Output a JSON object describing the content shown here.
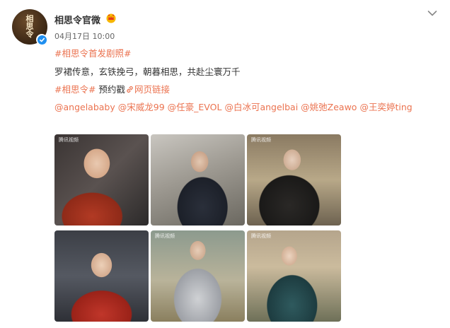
{
  "post": {
    "username": "相思令官微",
    "timestamp": "04月17日 10:00",
    "avatar_text": [
      "相",
      "思",
      "令"
    ],
    "hashtag_line": "#相思令首发剧照#",
    "body_text": "罗裙传意，玄铁挽弓，朝暮相思，共赴尘寰万千",
    "topic_tag": "#相思令#",
    "reserve_text": " 预约戳",
    "web_link_text": "网页链接",
    "mentions": [
      "@angelababy",
      "@宋威龙99",
      "@任豪_EVOL",
      "@白冰可angelbai",
      "@姚弛Zeawo",
      "@王奕婷ting"
    ]
  },
  "photos": [
    {
      "watermark": "腾讯视频"
    },
    {
      "watermark": ""
    },
    {
      "watermark": "腾讯视频"
    },
    {
      "watermark": ""
    },
    {
      "watermark": "腾讯视频"
    },
    {
      "watermark": "腾讯视频"
    }
  ],
  "icons": {
    "verified": "verified-badge-icon",
    "vip": "vip-crown-icon",
    "chevron": "chevron-down-icon",
    "link": "link-icon"
  },
  "colors": {
    "link": "#eb7350",
    "text": "#333333",
    "verified": "#1f8ff0"
  }
}
